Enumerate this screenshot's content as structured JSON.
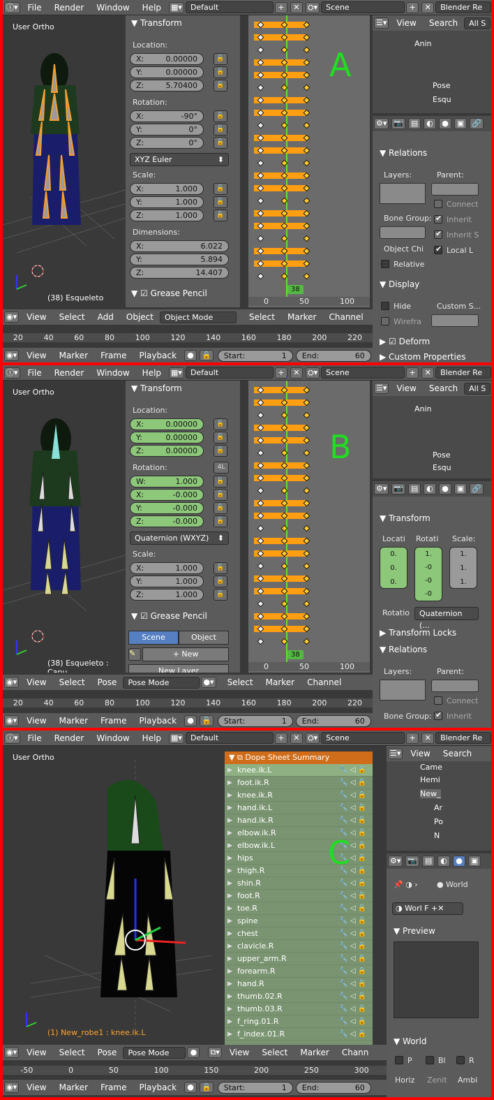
{
  "menu": {
    "file": "File",
    "render": "Render",
    "window": "Window",
    "help": "Help",
    "layout": "Default",
    "scene": "Scene",
    "engine": "Blender Re",
    "engine_c": "Blender Re"
  },
  "A": {
    "view_label": "User Ortho",
    "status": "(38) Esqueleto",
    "letter": "A",
    "npanel": {
      "transform": "Transform",
      "location": "Location:",
      "loc": [
        {
          "a": "X:",
          "v": "0.00000"
        },
        {
          "a": "Y:",
          "v": "0.00000"
        },
        {
          "a": "Z:",
          "v": "5.70400"
        }
      ],
      "rotation": "Rotation:",
      "rot": [
        {
          "a": "X:",
          "v": "-90°"
        },
        {
          "a": "Y:",
          "v": "0°"
        },
        {
          "a": "Z:",
          "v": "0°"
        }
      ],
      "rotmode": "XYZ Euler",
      "scale": "Scale:",
      "scl": [
        {
          "a": "X:",
          "v": "1.000"
        },
        {
          "a": "Y:",
          "v": "1.000"
        },
        {
          "a": "Z:",
          "v": "1.000"
        }
      ],
      "dimensions": "Dimensions:",
      "dim": [
        {
          "a": "X:",
          "v": "6.022"
        },
        {
          "a": "Y:",
          "v": "5.894"
        },
        {
          "a": "Z:",
          "v": "14.407"
        }
      ],
      "grease": "Grease Pencil"
    },
    "vpheader": {
      "view": "View",
      "select": "Select",
      "add": "Add",
      "object": "Object",
      "mode": "Object Mode"
    },
    "dope": {
      "frame": "38",
      "ticks": [
        "0",
        "50",
        "100"
      ],
      "select": "Select",
      "marker": "Marker",
      "channel": "Channel"
    },
    "outliner": {
      "view": "View",
      "search": "Search",
      "all": "All S",
      "items": [
        "Anin",
        "Pose",
        "Esqu"
      ]
    },
    "props": {
      "relations": "Relations",
      "layers": "Layers:",
      "parent": "Parent:",
      "connect": "Connect",
      "bone_group": "Bone Group:",
      "inherit": "Inherit",
      "inherit_s": "Inherit S",
      "object_chi": "Object Chi",
      "local_l": "Local L",
      "relative": "Relative",
      "display": "Display",
      "hide": "Hide",
      "custom_s": "Custom S...",
      "wirefra": "Wirefra",
      "deform": "Deform",
      "custom_props": "Custom Properties"
    },
    "ruler": [
      "20",
      "40",
      "60",
      "80",
      "100",
      "120",
      "140",
      "160",
      "180",
      "200",
      "220"
    ],
    "timeline": {
      "view": "View",
      "marker": "Marker",
      "frame": "Frame",
      "playback": "Playback",
      "start_label": "Start:",
      "start": "1",
      "end_label": "End:",
      "end": "60"
    }
  },
  "B": {
    "view_label": "User Ortho",
    "status": "(38) Esqueleto : Capu",
    "letter": "B",
    "npanel": {
      "transform": "Transform",
      "location": "Location:",
      "loc": [
        {
          "a": "X:",
          "v": "0.00000"
        },
        {
          "a": "Y:",
          "v": "0.00000"
        },
        {
          "a": "Z:",
          "v": "0.00000"
        }
      ],
      "rotation": "Rotation:",
      "fourl": "4L",
      "rot": [
        {
          "a": "W:",
          "v": "1.000"
        },
        {
          "a": "X:",
          "v": "-0.000"
        },
        {
          "a": "Y:",
          "v": "-0.000"
        },
        {
          "a": "Z:",
          "v": "-0.000"
        }
      ],
      "rotmode": "Quaternion (WXYZ)",
      "scale": "Scale:",
      "scl": [
        {
          "a": "X:",
          "v": "1.000"
        },
        {
          "a": "Y:",
          "v": "1.000"
        },
        {
          "a": "Z:",
          "v": "1.000"
        }
      ],
      "grease": "Grease Pencil",
      "scene_tab": "Scene",
      "object_tab": "Object",
      "new": "New",
      "new_layer": "New Layer"
    },
    "vpheader": {
      "view": "View",
      "select": "Select",
      "pose": "Pose",
      "mode": "Pose Mode"
    },
    "dope": {
      "frame": "38",
      "ticks": [
        "0",
        "50",
        "100"
      ],
      "select": "Select",
      "marker": "Marker",
      "channel": "Channel"
    },
    "outliner": {
      "view": "View",
      "search": "Search",
      "all": "All S",
      "items": [
        "Anin",
        "Pose",
        "Esqu"
      ]
    },
    "props": {
      "transform": "Transform",
      "locati": "Locati",
      "rotati": "Rotati",
      "scale": "Scale:",
      "loc": [
        "0.",
        "0.",
        "0."
      ],
      "rot": [
        "1.",
        "-0",
        "-0",
        "-0"
      ],
      "scl": [
        "1.",
        "1.",
        "1."
      ],
      "rotatio": "Rotatio",
      "rotmode": "Quaternion (...",
      "locks": "Transform Locks",
      "relations": "Relations",
      "layers": "Layers:",
      "parent": "Parent:",
      "connect": "Connect",
      "bone_group": "Bone Group:",
      "inherit": "Inherit"
    },
    "ruler": [
      "20",
      "40",
      "60",
      "80",
      "100",
      "120",
      "140",
      "160",
      "180",
      "200",
      "220"
    ],
    "timeline": {
      "view": "View",
      "marker": "Marker",
      "frame": "Frame",
      "playback": "Playback",
      "start_label": "Start:",
      "start": "1",
      "end_label": "End:",
      "end": "60"
    }
  },
  "C": {
    "view_label": "User Ortho",
    "status": "(1) New_robe1 : knee.ik.L",
    "letter": "C",
    "dope_title": "Dope Sheet Summary",
    "channels": [
      "knee.ik.L",
      "foot.ik.R",
      "knee.ik.R",
      "hand.ik.L",
      "hand.ik.R",
      "elbow.ik.R",
      "elbow.ik.L",
      "hips",
      "thigh.R",
      "shin.R",
      "foot.R",
      "toe.R",
      "spine",
      "chest",
      "clavicle.R",
      "upper_arm.R",
      "forearm.R",
      "hand.R",
      "thumb.02.R",
      "thumb.03.R",
      "f_ring.01.R",
      "f_index.01.R"
    ],
    "vpheader": {
      "view": "View",
      "select": "Select",
      "pose": "Pose",
      "mode": "Pose Mode"
    },
    "dopeheader": {
      "view": "View",
      "select": "Select",
      "marker": "Marker",
      "channel": "Chann"
    },
    "outliner": {
      "view": "View",
      "search": "Search",
      "items": [
        "Came",
        "Hemi",
        "New_",
        "Ar",
        "Po",
        "N"
      ]
    },
    "props": {
      "world_crumb": "World",
      "world_field": "Worl",
      "f": "F",
      "preview": "Preview",
      "world": "World",
      "p": "P",
      "bl": "Bl",
      "r": "R",
      "horiz": "Horiz",
      "zenit": "Zenit",
      "ambi": "Ambi"
    },
    "ruler": [
      "-50",
      "0",
      "50",
      "100",
      "150",
      "200",
      "250",
      "300"
    ],
    "timeline": {
      "view": "View",
      "marker": "Marker",
      "frame": "Frame",
      "playback": "Playback",
      "start_label": "Start:",
      "start": "1",
      "end_label": "End:",
      "end": "60"
    }
  }
}
